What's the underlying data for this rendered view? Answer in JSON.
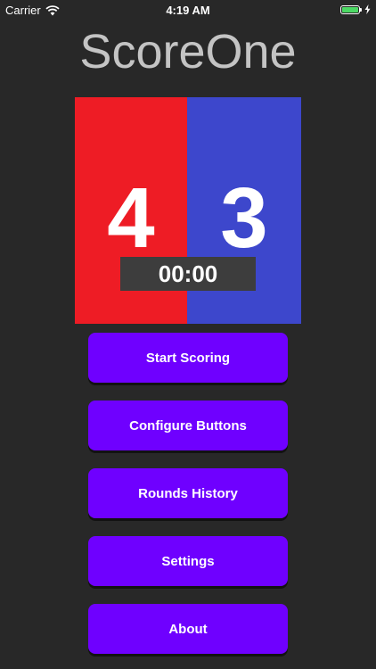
{
  "status_bar": {
    "carrier": "Carrier",
    "time": "4:19 AM",
    "battery_level": 1.0,
    "battery_color": "#4cd964",
    "icons": [
      "wifi-icon",
      "battery-icon",
      "charging-bolt-icon"
    ]
  },
  "app": {
    "title": "ScoreOne"
  },
  "scoreboard": {
    "left_score": "4",
    "right_score": "3",
    "timer": "00:00",
    "left_color": "#ee1c25",
    "right_color": "#3d47cc"
  },
  "menu": {
    "button_color": "#6f00ff",
    "items": [
      {
        "label": "Start Scoring"
      },
      {
        "label": "Configure Buttons"
      },
      {
        "label": "Rounds History"
      },
      {
        "label": "Settings"
      },
      {
        "label": "About"
      }
    ]
  }
}
